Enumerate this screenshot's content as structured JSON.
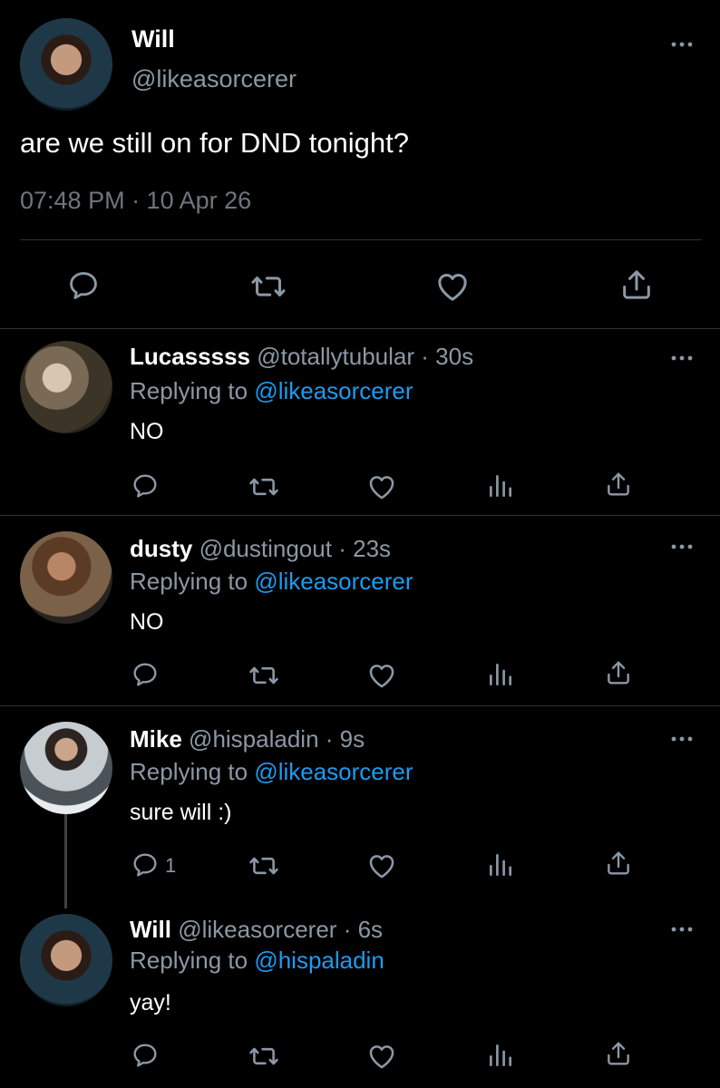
{
  "tweet": {
    "name": "Will",
    "handle": "@likeasorcerer",
    "text": "are we still on for DND tonight?",
    "timestamp": "07:48 PM · 10 Apr 26"
  },
  "replies": [
    {
      "name": "Lucasssss",
      "handle": "@totallytubular",
      "time": "30s",
      "replying_prefix": "Replying to ",
      "replying_to": "@likeasorcerer",
      "text": "NO",
      "reply_count": ""
    },
    {
      "name": "dusty",
      "handle": "@dustingout",
      "time": "23s",
      "replying_prefix": "Replying to ",
      "replying_to": "@likeasorcerer",
      "text": "NO",
      "reply_count": ""
    },
    {
      "name": "Mike",
      "handle": "@hispaladin",
      "time": "9s",
      "replying_prefix": "Replying to ",
      "replying_to": "@likeasorcerer",
      "text": "sure will :)",
      "reply_count": "1"
    },
    {
      "name": "Will",
      "handle": "@likeasorcerer",
      "time": "6s",
      "replying_prefix": "Replying to ",
      "replying_to": "@hispaladin",
      "text": "yay!",
      "reply_count": ""
    }
  ],
  "separator": "·",
  "colors": {
    "background": "#000000",
    "link": "#1d9bf0",
    "secondary_text": "#8b98a5",
    "divider": "#2f3336"
  },
  "icons": [
    "more-icon",
    "reply-icon",
    "retweet-icon",
    "like-icon",
    "analytics-icon",
    "share-icon"
  ]
}
